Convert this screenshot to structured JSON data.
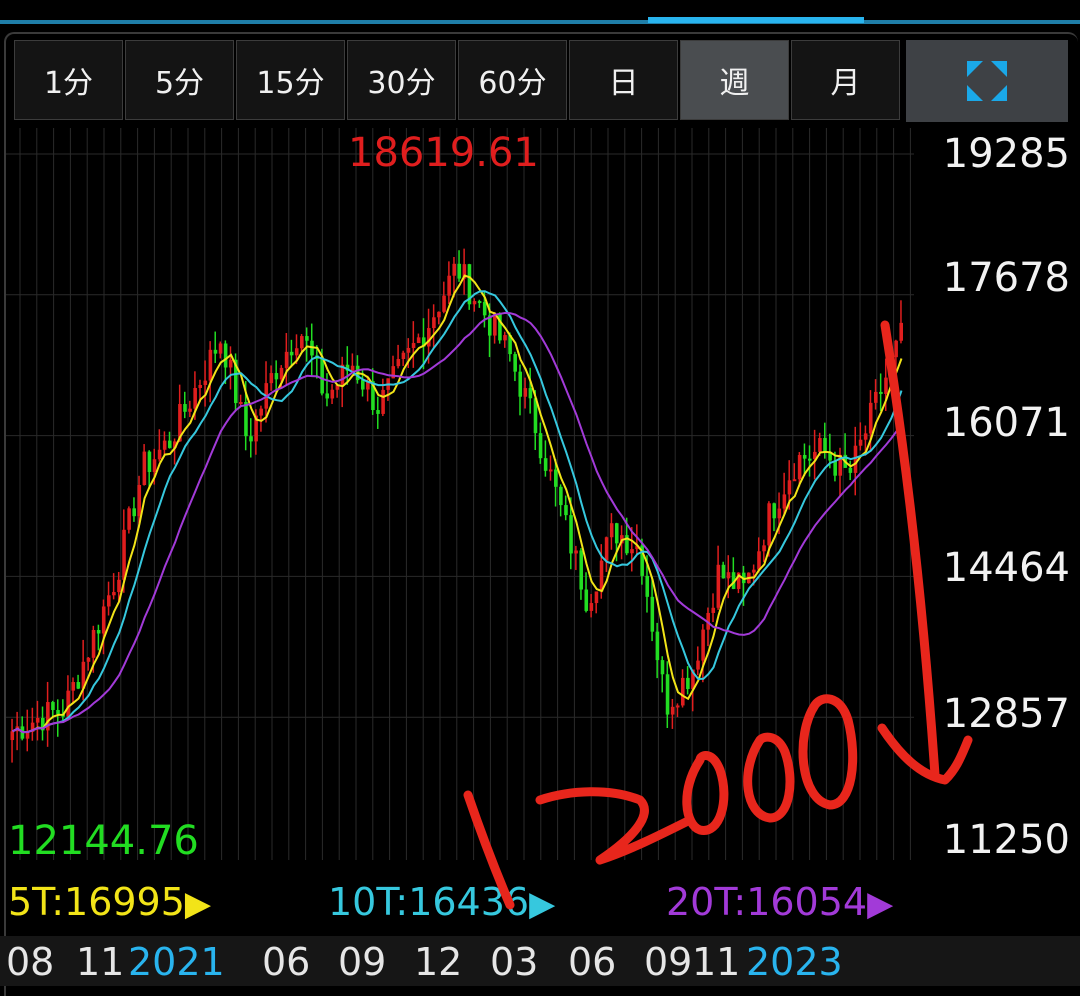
{
  "tabs": [
    {
      "label": "1分",
      "active": false
    },
    {
      "label": "5分",
      "active": false
    },
    {
      "label": "15分",
      "active": false
    },
    {
      "label": "30分",
      "active": false
    },
    {
      "label": "60分",
      "active": false
    },
    {
      "label": "日",
      "active": false
    },
    {
      "label": "週",
      "active": true
    },
    {
      "label": "月",
      "active": false
    }
  ],
  "fullscreen_icon": "fullscreen-expand-icon",
  "colors": {
    "up": "#e01e1e",
    "down": "#22dd22",
    "ma5": "#f2e418",
    "ma10": "#36c8de",
    "ma20": "#a23ad8",
    "accent": "#29b4ee",
    "annotation": "#e8261c"
  },
  "chart_data": {
    "type": "candlestick",
    "y_ticks": [
      "19285",
      "17678",
      "16071",
      "14464",
      "12857",
      "11250"
    ],
    "ylim": [
      11250,
      19285
    ],
    "high_label": "18619.61",
    "low_label": "12144.76",
    "x_tick_labels": [
      "08",
      "11",
      "2021",
      "06",
      "09",
      "12",
      "03",
      "06",
      "09",
      "11",
      "2023"
    ],
    "moving_averages": [
      {
        "name": "5T",
        "value": "16995",
        "color": "#f2e418"
      },
      {
        "name": "10T",
        "value": "16436",
        "color": "#36c8de"
      },
      {
        "name": "20T",
        "value": "16054",
        "color": "#a23ad8"
      }
    ],
    "series_close_anchors": [
      12700,
      12850,
      12950,
      13700,
      14500,
      15700,
      16000,
      16600,
      17200,
      16000,
      16800,
      17300,
      16500,
      16900,
      16400,
      16900,
      17400,
      18000,
      17500,
      17000,
      16200,
      15200,
      14200,
      15000,
      14800,
      13000,
      13400,
      14500,
      14300,
      15200,
      15800,
      15900,
      15600,
      16400,
      17200
    ],
    "handwritten_annotation": "12000"
  }
}
